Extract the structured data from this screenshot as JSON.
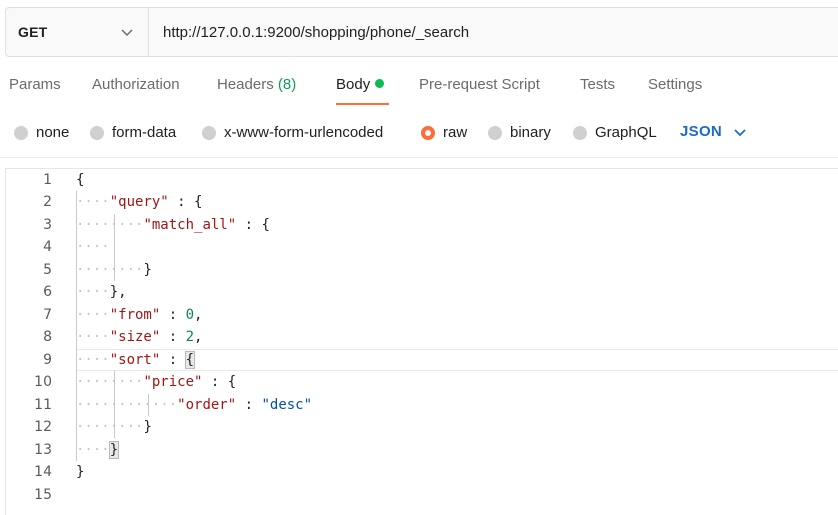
{
  "request": {
    "method": "GET",
    "url": "http://127.0.0.1:9200/shopping/phone/_search"
  },
  "tabs": {
    "params": "Params",
    "authorization": "Authorization",
    "headers": "Headers",
    "headers_count": "(8)",
    "body": "Body",
    "prerequest": "Pre-request Script",
    "tests": "Tests",
    "settings": "Settings"
  },
  "body_types": {
    "none": "none",
    "form_data": "form-data",
    "urlencoded": "x-www-form-urlencoded",
    "raw": "raw",
    "binary": "binary",
    "graphql": "GraphQL",
    "format": "JSON",
    "selected": "raw"
  },
  "editor": {
    "line_numbers": [
      "1",
      "2",
      "3",
      "4",
      "5",
      "6",
      "7",
      "8",
      "9",
      "10",
      "11",
      "12",
      "13",
      "14",
      "15"
    ],
    "tokens": {
      "l1_open": "{",
      "l2_key": "\"query\"",
      "l2_colon": " : ",
      "l2_open": "{",
      "l3_key": "\"match_all\"",
      "l3_colon": " : ",
      "l3_open": "{",
      "l5_close": "}",
      "l6_close": "},",
      "l7_key": "\"from\"",
      "l7_colon": " : ",
      "l7_val": "0",
      "l7_comma": ",",
      "l8_key": "\"size\"",
      "l8_colon": " : ",
      "l8_val": "2",
      "l8_comma": ",",
      "l9_key": "\"sort\"",
      "l9_colon": " : ",
      "l9_open": "{",
      "l10_key": "\"price\"",
      "l10_colon": " : ",
      "l10_open": "{",
      "l11_key": "\"order\"",
      "l11_colon": " : ",
      "l11_val": "\"desc\"",
      "l12_close": "}",
      "l13_close": "}",
      "l14_close": "}"
    }
  },
  "colors": {
    "accent": "#ff6c37",
    "status_dot": "#0cbb52",
    "headers_count": "#0f9d58",
    "json_label": "#1b6ac9"
  }
}
